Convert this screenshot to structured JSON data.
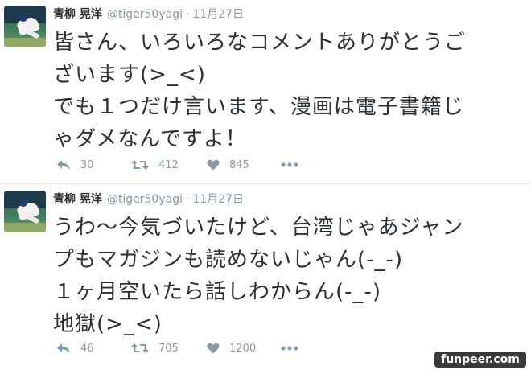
{
  "tweets": [
    {
      "author": {
        "name": "青柳 晃洋",
        "handle": "@tiger50yagi"
      },
      "date": "11月27日",
      "lines": [
        "皆さん、いろいろなコメントありがとうご",
        "ざいます(>_<)",
        "でも１つだけ言います、漫画は電子書籍じ",
        "ゃダメなんですよ！"
      ],
      "stats": {
        "replies": "30",
        "retweets": "412",
        "likes": "845"
      }
    },
    {
      "author": {
        "name": "青柳 晃洋",
        "handle": "@tiger50yagi"
      },
      "date": "11月27日",
      "lines": [
        "うわ〜今気づいたけど、台湾じゃあジャン",
        "プもマガジンも読めないじゃん(-_-)",
        "１ヶ月空いたら話しわからん(-_-)",
        "地獄(>_<)"
      ],
      "stats": {
        "replies": "46",
        "retweets": "705",
        "likes": "1200"
      }
    }
  ],
  "icons": [
    "reply-icon",
    "retweet-icon",
    "like-icon",
    "more-icon"
  ],
  "colors": {
    "text": "#292f33",
    "secondary": "#8899a6",
    "divider": "#e1e8ed"
  },
  "watermark": "funpeer.com"
}
